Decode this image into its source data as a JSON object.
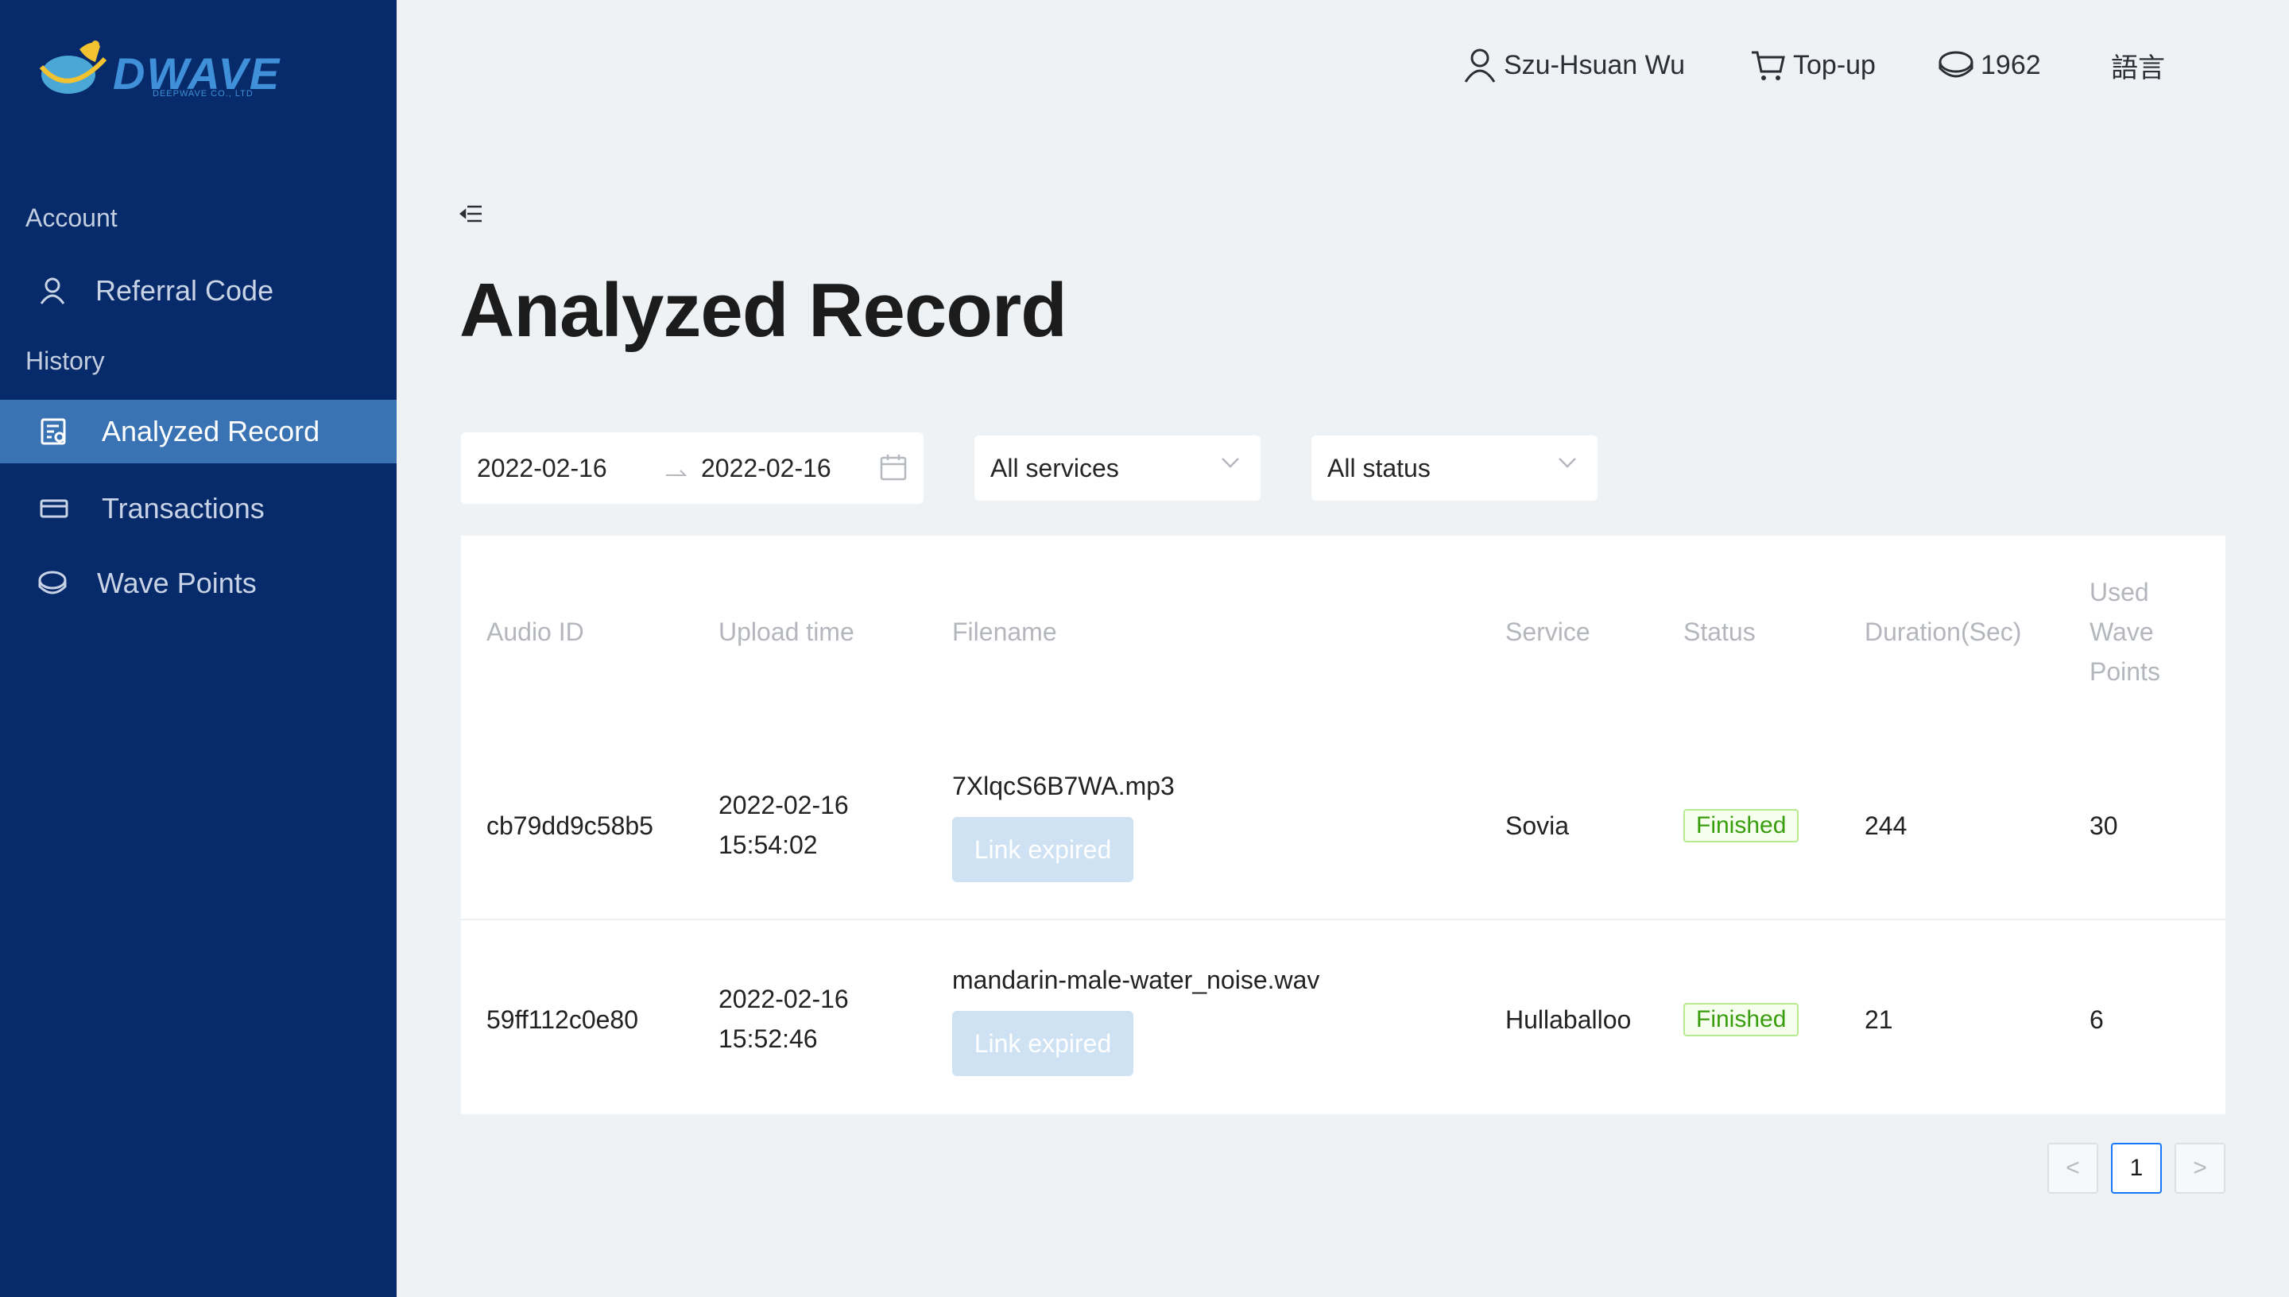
{
  "brand": {
    "name": "DWAVE",
    "tagline": "DEEPWAVE CO., LTD"
  },
  "sidebar": {
    "groups": [
      {
        "label": "Account"
      },
      {
        "label": "History"
      }
    ],
    "items": [
      {
        "label": "Referral Code",
        "icon": "user-icon"
      },
      {
        "label": "Analyzed Record",
        "icon": "record-search-icon",
        "active": true
      },
      {
        "label": "Transactions",
        "icon": "card-icon"
      },
      {
        "label": "Wave Points",
        "icon": "coin-icon"
      }
    ]
  },
  "header": {
    "user_name": "Szu-Hsuan Wu",
    "topup_label": "Top-up",
    "points": "1962",
    "language_label": "語言"
  },
  "page": {
    "title": "Analyzed Record"
  },
  "filters": {
    "date_start": "2022-02-16",
    "date_end": "2022-02-16",
    "service": "All services",
    "status": "All status"
  },
  "table": {
    "columns": [
      "Audio ID",
      "Upload time",
      "Filename",
      "Service",
      "Status",
      "Duration(Sec)",
      "Used Wave Points"
    ],
    "col_used_lines": [
      "Used",
      "Wave",
      "Points"
    ],
    "rows": [
      {
        "audio_id": "cb79dd9c58b5",
        "upload_date": "2022-02-16",
        "upload_time": "15:54:02",
        "filename": "7XlqcS6B7WA.mp3",
        "link_label": "Link expired",
        "service": "Sovia",
        "status": "Finished",
        "duration": "244",
        "used_points": "30"
      },
      {
        "audio_id": "59ff112c0e80",
        "upload_date": "2022-02-16",
        "upload_time": "15:52:46",
        "filename": "mandarin-male-water_noise.wav",
        "link_label": "Link expired",
        "service": "Hullaballoo",
        "status": "Finished",
        "duration": "21",
        "used_points": "6"
      }
    ]
  },
  "pagination": {
    "prev": "<",
    "current": "1",
    "next": ">"
  },
  "colors": {
    "sidebar": "#062a6a",
    "active": "#3a73b3",
    "accent": "#1677ff",
    "success": "#389e0d"
  }
}
